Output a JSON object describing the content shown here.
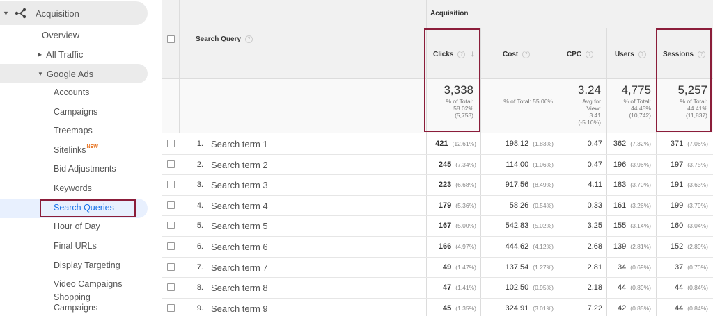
{
  "sidebar": {
    "section_title": "Acquisition",
    "overview": "Overview",
    "all_traffic": "All Traffic",
    "google_ads": "Google Ads",
    "items": [
      {
        "label": "Accounts"
      },
      {
        "label": "Campaigns"
      },
      {
        "label": "Treemaps"
      },
      {
        "label": "Sitelinks",
        "badge": "NEW"
      },
      {
        "label": "Bid Adjustments"
      },
      {
        "label": "Keywords"
      },
      {
        "label": "Search Queries"
      },
      {
        "label": "Hour of Day"
      },
      {
        "label": "Final URLs"
      },
      {
        "label": "Display Targeting"
      },
      {
        "label": "Video Campaigns"
      },
      {
        "label": "Shopping Campaigns"
      }
    ]
  },
  "table": {
    "group_header": "Acquisition",
    "dimension_header": "Search Query",
    "columns": [
      "Clicks",
      "Cost",
      "CPC",
      "Users",
      "Sessions"
    ],
    "totals": {
      "clicks": {
        "value": "3,338",
        "l1": "% of Total:",
        "l2": "58.02%",
        "l3": "(5,753)"
      },
      "cost": {
        "l1": "% of Total: 55.06%"
      },
      "cpc": {
        "value": "3.24",
        "l1": "Avg for",
        "l2": "View:",
        "l3": "3.41",
        "l4": "(-5.10%)"
      },
      "users": {
        "value": "4,775",
        "l1": "% of Total:",
        "l2": "44.45%",
        "l3": "(10,742)"
      },
      "sessions": {
        "value": "5,257",
        "l1": "% of Total:",
        "l2": "44.41%",
        "l3": "(11,837)"
      }
    },
    "rows": [
      {
        "num": "1.",
        "term": "Search term 1",
        "clicks": "421",
        "clicks_pct": "(12.61%)",
        "cost": "198.12",
        "cost_pct": "(1.83%)",
        "cpc": "0.47",
        "users": "362",
        "users_pct": "(7.32%)",
        "sessions": "371",
        "sessions_pct": "(7.06%)"
      },
      {
        "num": "2.",
        "term": "Search term 2",
        "clicks": "245",
        "clicks_pct": "(7.34%)",
        "cost": "114.00",
        "cost_pct": "(1.06%)",
        "cpc": "0.47",
        "users": "196",
        "users_pct": "(3.96%)",
        "sessions": "197",
        "sessions_pct": "(3.75%)"
      },
      {
        "num": "3.",
        "term": "Search term 3",
        "clicks": "223",
        "clicks_pct": "(6.68%)",
        "cost": "917.56",
        "cost_pct": "(8.49%)",
        "cpc": "4.11",
        "users": "183",
        "users_pct": "(3.70%)",
        "sessions": "191",
        "sessions_pct": "(3.63%)"
      },
      {
        "num": "4.",
        "term": "Search term 4",
        "clicks": "179",
        "clicks_pct": "(5.36%)",
        "cost": "58.26",
        "cost_pct": "(0.54%)",
        "cpc": "0.33",
        "users": "161",
        "users_pct": "(3.26%)",
        "sessions": "199",
        "sessions_pct": "(3.79%)"
      },
      {
        "num": "5.",
        "term": "Search term 5",
        "clicks": "167",
        "clicks_pct": "(5.00%)",
        "cost": "542.83",
        "cost_pct": "(5.02%)",
        "cpc": "3.25",
        "users": "155",
        "users_pct": "(3.14%)",
        "sessions": "160",
        "sessions_pct": "(3.04%)"
      },
      {
        "num": "6.",
        "term": "Search term 6",
        "clicks": "166",
        "clicks_pct": "(4.97%)",
        "cost": "444.62",
        "cost_pct": "(4.12%)",
        "cpc": "2.68",
        "users": "139",
        "users_pct": "(2.81%)",
        "sessions": "152",
        "sessions_pct": "(2.89%)"
      },
      {
        "num": "7.",
        "term": "Search term 7",
        "clicks": "49",
        "clicks_pct": "(1.47%)",
        "cost": "137.54",
        "cost_pct": "(1.27%)",
        "cpc": "2.81",
        "users": "34",
        "users_pct": "(0.69%)",
        "sessions": "37",
        "sessions_pct": "(0.70%)"
      },
      {
        "num": "8.",
        "term": "Search term 8",
        "clicks": "47",
        "clicks_pct": "(1.41%)",
        "cost": "102.50",
        "cost_pct": "(0.95%)",
        "cpc": "2.18",
        "users": "44",
        "users_pct": "(0.89%)",
        "sessions": "44",
        "sessions_pct": "(0.84%)"
      },
      {
        "num": "9.",
        "term": "Search term 9",
        "clicks": "45",
        "clicks_pct": "(1.35%)",
        "cost": "324.91",
        "cost_pct": "(3.01%)",
        "cpc": "7.22",
        "users": "42",
        "users_pct": "(0.85%)",
        "sessions": "44",
        "sessions_pct": "(0.84%)"
      }
    ]
  },
  "icons": {
    "acquisition": "acquisition-branch-icon",
    "expand": "caret-down-icon",
    "collapsed": "caret-right-icon",
    "help": "help-circle-icon",
    "sort": "sort-down-arrow-icon"
  },
  "colors": {
    "highlight_box": "#8b1d3a",
    "active_text": "#1a73e8",
    "active_bg": "#e8f0fe",
    "badge_new": "#e8711c"
  }
}
